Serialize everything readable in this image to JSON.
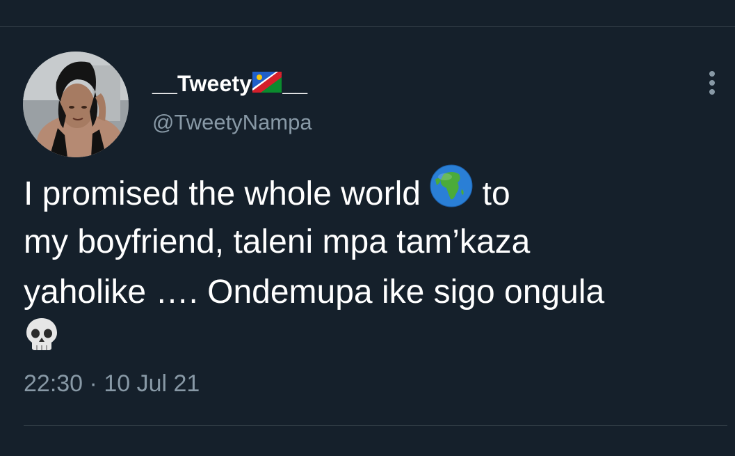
{
  "tweet": {
    "author": {
      "display_name_prefix": "__Tweety",
      "display_name_suffix": "__",
      "flag_icon": "namibia-flag-icon",
      "username": "@TweetyNampa"
    },
    "text_lines": [
      "I promised the whole world",
      "to",
      "my boyfriend, taleni mpa tam’kaza",
      "yaholike …. Ondemupa ike sigo ongula"
    ],
    "emojis": [
      "globe-africa-icon",
      "skull-icon"
    ],
    "time": "22:30",
    "separator": "·",
    "date": "10 Jul 21"
  },
  "theme": {
    "background": "#15202b",
    "text": "#ffffff",
    "secondary_text": "#8899a6",
    "divider": "#38444d"
  }
}
